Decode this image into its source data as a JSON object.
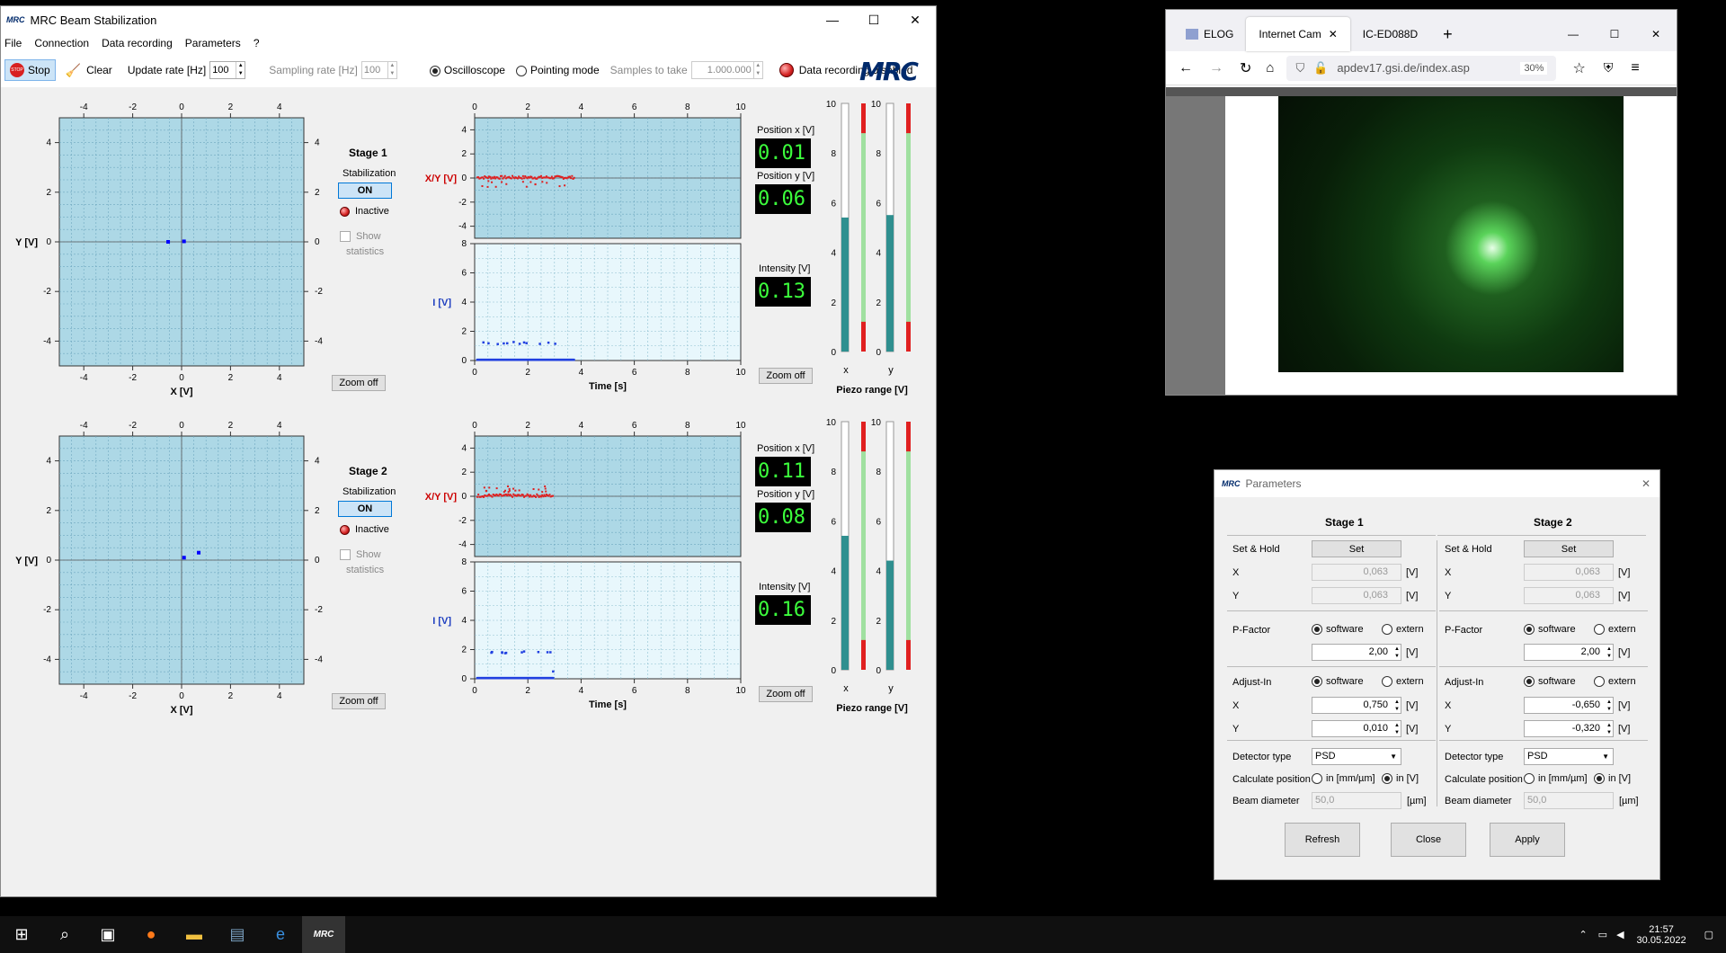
{
  "main_window": {
    "title": "MRC Beam Stabilization",
    "logo": "MRC",
    "menu": [
      "File",
      "Connection",
      "Data recording",
      "Parameters",
      "?"
    ],
    "toolbar": {
      "stop_label": "Stop",
      "clear_label": "Clear",
      "update_rate_label": "Update rate [Hz]",
      "update_rate_value": "100",
      "sampling_rate_label": "Sampling rate [Hz]",
      "sampling_rate_value": "100",
      "oscilloscope_label": "Oscilloscope",
      "pointing_label": "Pointing mode",
      "samples_label": "Samples to take",
      "samples_value": "1.000.000",
      "recording_status": "Data recording disabled"
    }
  },
  "stages": [
    {
      "title": "Stage 1",
      "stabilization_label": "Stabilization",
      "toggle_label": "ON",
      "status": "Inactive",
      "show_stats_line1": "Show",
      "show_stats_line2": "statistics",
      "zoom_off_label": "Zoom off",
      "zoom_off_label2": "Zoom off",
      "pos_x_label": "Position x [V]",
      "pos_x_value": "0.01",
      "pos_y_label": "Position y [V]",
      "pos_y_value": "0.06",
      "intensity_label": "Intensity [V]",
      "intensity_value": "0.13",
      "piezo_label": "Piezo range [V]",
      "piezo_x": 0.54,
      "piezo_y": 0.55
    },
    {
      "title": "Stage 2",
      "stabilization_label": "Stabilization",
      "toggle_label": "ON",
      "status": "Inactive",
      "show_stats_line1": "Show",
      "show_stats_line2": "statistics",
      "zoom_off_label": "Zoom off",
      "zoom_off_label2": "Zoom off",
      "pos_x_label": "Position x [V]",
      "pos_x_value": "0.11",
      "pos_y_label": "Position y [V]",
      "pos_y_value": "0.08",
      "intensity_label": "Intensity [V]",
      "intensity_value": "0.16",
      "piezo_label": "Piezo range [V]",
      "piezo_x": 0.54,
      "piezo_y": 0.44
    }
  ],
  "chart_data": [
    {
      "type": "scatter",
      "xlabel": "X [V]",
      "ylabel": "Y [V]",
      "xlim": [
        -5,
        5
      ],
      "ylim": [
        -5,
        5
      ],
      "points": [
        [
          -0.55,
          0
        ],
        [
          0.1,
          0.02
        ]
      ]
    },
    {
      "type": "scatter",
      "xlabel": "",
      "ylabel": "X/Y [V]",
      "xlim": [
        0,
        10
      ],
      "ylim": [
        -5,
        5
      ]
    },
    {
      "type": "scatter",
      "xlabel": "Time [s]",
      "ylabel": "I [V]",
      "xlim": [
        0,
        10
      ],
      "ylim": [
        0,
        8
      ]
    },
    {
      "type": "scatter",
      "xlabel": "X [V]",
      "ylabel": "Y [V]",
      "xlim": [
        -5,
        5
      ],
      "ylim": [
        -5,
        5
      ],
      "points": [
        [
          0.1,
          0.1
        ],
        [
          0.7,
          0.3
        ]
      ]
    },
    {
      "type": "scatter",
      "xlabel": "",
      "ylabel": "X/Y [V]",
      "xlim": [
        0,
        10
      ],
      "ylim": [
        -5,
        5
      ]
    },
    {
      "type": "scatter",
      "xlabel": "Time [s]",
      "ylabel": "I [V]",
      "xlim": [
        0,
        10
      ],
      "ylim": [
        0,
        8
      ]
    }
  ],
  "browser": {
    "tabs": [
      "ELOG",
      "Internet Cam",
      "IC-ED088D"
    ],
    "url_host": "apdev17.gsi.de",
    "url_path": "/index.asp",
    "zoom": "30%"
  },
  "params": {
    "title": "Parameters",
    "stage1": "Stage 1",
    "stage2": "Stage 2",
    "setHold": "Set & Hold",
    "set": "Set",
    "x": "X",
    "y": "Y",
    "s1_sh_x": "0,063",
    "s1_sh_y": "0,063",
    "s2_sh_x": "0,063",
    "s2_sh_y": "0,063",
    "unitV": "[V]",
    "pfactor": "P-Factor",
    "software": "software",
    "extern": "extern",
    "s1_pf": "2,00",
    "s2_pf": "2,00",
    "adjust": "Adjust-In",
    "s1_ax": "0,750",
    "s1_ay": "0,010",
    "s2_ax": "-0,650",
    "s2_ay": "-0,320",
    "detector": "Detector type",
    "psd": "PSD",
    "calc": "Calculate position",
    "in_mm": "in [mm/µm]",
    "in_v": "in [V]",
    "beam": "Beam diameter",
    "beam_val": "50,0",
    "unitUm": "[µm]",
    "refresh": "Refresh",
    "close": "Close",
    "apply": "Apply"
  },
  "taskbar": {
    "time": "21:57",
    "date": "30.05.2022"
  }
}
